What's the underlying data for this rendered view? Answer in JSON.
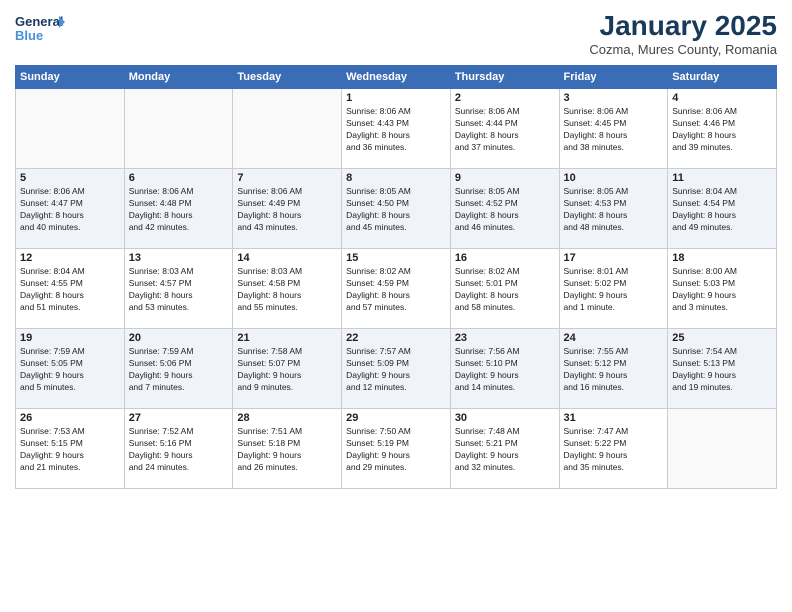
{
  "logo": {
    "line1": "General",
    "line2": "Blue"
  },
  "title": "January 2025",
  "subtitle": "Cozma, Mures County, Romania",
  "weekdays": [
    "Sunday",
    "Monday",
    "Tuesday",
    "Wednesday",
    "Thursday",
    "Friday",
    "Saturday"
  ],
  "weeks": [
    [
      {
        "day": "",
        "info": ""
      },
      {
        "day": "",
        "info": ""
      },
      {
        "day": "",
        "info": ""
      },
      {
        "day": "1",
        "info": "Sunrise: 8:06 AM\nSunset: 4:43 PM\nDaylight: 8 hours\nand 36 minutes."
      },
      {
        "day": "2",
        "info": "Sunrise: 8:06 AM\nSunset: 4:44 PM\nDaylight: 8 hours\nand 37 minutes."
      },
      {
        "day": "3",
        "info": "Sunrise: 8:06 AM\nSunset: 4:45 PM\nDaylight: 8 hours\nand 38 minutes."
      },
      {
        "day": "4",
        "info": "Sunrise: 8:06 AM\nSunset: 4:46 PM\nDaylight: 8 hours\nand 39 minutes."
      }
    ],
    [
      {
        "day": "5",
        "info": "Sunrise: 8:06 AM\nSunset: 4:47 PM\nDaylight: 8 hours\nand 40 minutes."
      },
      {
        "day": "6",
        "info": "Sunrise: 8:06 AM\nSunset: 4:48 PM\nDaylight: 8 hours\nand 42 minutes."
      },
      {
        "day": "7",
        "info": "Sunrise: 8:06 AM\nSunset: 4:49 PM\nDaylight: 8 hours\nand 43 minutes."
      },
      {
        "day": "8",
        "info": "Sunrise: 8:05 AM\nSunset: 4:50 PM\nDaylight: 8 hours\nand 45 minutes."
      },
      {
        "day": "9",
        "info": "Sunrise: 8:05 AM\nSunset: 4:52 PM\nDaylight: 8 hours\nand 46 minutes."
      },
      {
        "day": "10",
        "info": "Sunrise: 8:05 AM\nSunset: 4:53 PM\nDaylight: 8 hours\nand 48 minutes."
      },
      {
        "day": "11",
        "info": "Sunrise: 8:04 AM\nSunset: 4:54 PM\nDaylight: 8 hours\nand 49 minutes."
      }
    ],
    [
      {
        "day": "12",
        "info": "Sunrise: 8:04 AM\nSunset: 4:55 PM\nDaylight: 8 hours\nand 51 minutes."
      },
      {
        "day": "13",
        "info": "Sunrise: 8:03 AM\nSunset: 4:57 PM\nDaylight: 8 hours\nand 53 minutes."
      },
      {
        "day": "14",
        "info": "Sunrise: 8:03 AM\nSunset: 4:58 PM\nDaylight: 8 hours\nand 55 minutes."
      },
      {
        "day": "15",
        "info": "Sunrise: 8:02 AM\nSunset: 4:59 PM\nDaylight: 8 hours\nand 57 minutes."
      },
      {
        "day": "16",
        "info": "Sunrise: 8:02 AM\nSunset: 5:01 PM\nDaylight: 8 hours\nand 58 minutes."
      },
      {
        "day": "17",
        "info": "Sunrise: 8:01 AM\nSunset: 5:02 PM\nDaylight: 9 hours\nand 1 minute."
      },
      {
        "day": "18",
        "info": "Sunrise: 8:00 AM\nSunset: 5:03 PM\nDaylight: 9 hours\nand 3 minutes."
      }
    ],
    [
      {
        "day": "19",
        "info": "Sunrise: 7:59 AM\nSunset: 5:05 PM\nDaylight: 9 hours\nand 5 minutes."
      },
      {
        "day": "20",
        "info": "Sunrise: 7:59 AM\nSunset: 5:06 PM\nDaylight: 9 hours\nand 7 minutes."
      },
      {
        "day": "21",
        "info": "Sunrise: 7:58 AM\nSunset: 5:07 PM\nDaylight: 9 hours\nand 9 minutes."
      },
      {
        "day": "22",
        "info": "Sunrise: 7:57 AM\nSunset: 5:09 PM\nDaylight: 9 hours\nand 12 minutes."
      },
      {
        "day": "23",
        "info": "Sunrise: 7:56 AM\nSunset: 5:10 PM\nDaylight: 9 hours\nand 14 minutes."
      },
      {
        "day": "24",
        "info": "Sunrise: 7:55 AM\nSunset: 5:12 PM\nDaylight: 9 hours\nand 16 minutes."
      },
      {
        "day": "25",
        "info": "Sunrise: 7:54 AM\nSunset: 5:13 PM\nDaylight: 9 hours\nand 19 minutes."
      }
    ],
    [
      {
        "day": "26",
        "info": "Sunrise: 7:53 AM\nSunset: 5:15 PM\nDaylight: 9 hours\nand 21 minutes."
      },
      {
        "day": "27",
        "info": "Sunrise: 7:52 AM\nSunset: 5:16 PM\nDaylight: 9 hours\nand 24 minutes."
      },
      {
        "day": "28",
        "info": "Sunrise: 7:51 AM\nSunset: 5:18 PM\nDaylight: 9 hours\nand 26 minutes."
      },
      {
        "day": "29",
        "info": "Sunrise: 7:50 AM\nSunset: 5:19 PM\nDaylight: 9 hours\nand 29 minutes."
      },
      {
        "day": "30",
        "info": "Sunrise: 7:48 AM\nSunset: 5:21 PM\nDaylight: 9 hours\nand 32 minutes."
      },
      {
        "day": "31",
        "info": "Sunrise: 7:47 AM\nSunset: 5:22 PM\nDaylight: 9 hours\nand 35 minutes."
      },
      {
        "day": "",
        "info": ""
      }
    ]
  ]
}
